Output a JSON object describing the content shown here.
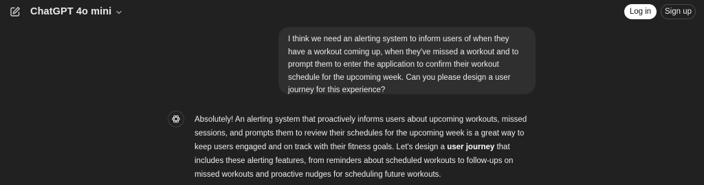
{
  "header": {
    "new_chat_icon": "edit-square-icon",
    "model_name": "ChatGPT 4o mini",
    "model_chevron_icon": "chevron-down-icon",
    "login_label": "Log in",
    "signup_label": "Sign up"
  },
  "conversation": {
    "user_message": "I think we need an alerting system to inform users of when they have a workout coming up, when they've missed a workout and to prompt them to enter the application to confirm their workout schedule for the upcoming week. Can you please design a user journey for this experience?",
    "assistant_avatar_icon": "openai-logo-icon",
    "assistant_text_1": "Absolutely! An alerting system that proactively informs users about upcoming workouts, missed sessions, and prompts them to review their schedules for the upcoming week is a great way to keep users engaged and on track with their fitness goals. Let's design a ",
    "assistant_bold": "user journey",
    "assistant_text_2": " that includes these alerting features, from reminders about scheduled workouts to follow-ups on missed workouts and proactive nudges for scheduling future workouts."
  },
  "colors": {
    "background": "#212121",
    "bubble": "#2f2f2f",
    "text": "#ececec",
    "login_bg": "#ffffff"
  }
}
